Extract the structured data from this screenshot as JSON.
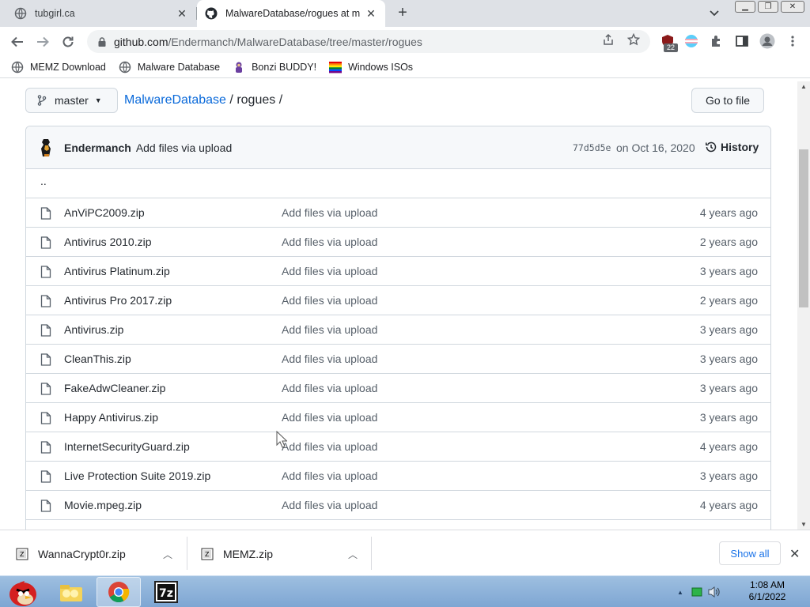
{
  "browser": {
    "tabs": [
      {
        "title": "tubgirl.ca",
        "active": false
      },
      {
        "title": "MalwareDatabase/rogues at m",
        "active": true
      }
    ],
    "new_tab_label": "+",
    "url_host": "github.com",
    "url_path": "/Endermanch/MalwareDatabase/tree/master/rogues",
    "extension_badge": "22",
    "bookmarks": [
      {
        "label": "MEMZ Download",
        "icon": "globe-icon"
      },
      {
        "label": "Malware Database",
        "icon": "globe-icon"
      },
      {
        "label": "Bonzi BUDDY!",
        "icon": "bonzi-icon"
      },
      {
        "label": "Windows ISOs",
        "icon": "windows-flag-icon"
      }
    ]
  },
  "repo": {
    "branch": "master",
    "repo_name": "MalwareDatabase",
    "folder": "rogues",
    "breadcrumb_sep": "/",
    "go_to_file": "Go to file",
    "commit": {
      "author": "Endermanch",
      "message": "Add files via upload",
      "sha": "77d5d5e",
      "date": "on Oct 16, 2020",
      "history_label": "History"
    },
    "parent_dir": "..",
    "files": [
      {
        "name": "AnViPC2009.zip",
        "message": "Add files via upload",
        "age": "4 years ago"
      },
      {
        "name": "Antivirus 2010.zip",
        "message": "Add files via upload",
        "age": "2 years ago"
      },
      {
        "name": "Antivirus Platinum.zip",
        "message": "Add files via upload",
        "age": "3 years ago"
      },
      {
        "name": "Antivirus Pro 2017.zip",
        "message": "Add files via upload",
        "age": "2 years ago"
      },
      {
        "name": "Antivirus.zip",
        "message": "Add files via upload",
        "age": "3 years ago"
      },
      {
        "name": "CleanThis.zip",
        "message": "Add files via upload",
        "age": "3 years ago"
      },
      {
        "name": "FakeAdwCleaner.zip",
        "message": "Add files via upload",
        "age": "3 years ago"
      },
      {
        "name": "Happy Antivirus.zip",
        "message": "Add files via upload",
        "age": "3 years ago"
      },
      {
        "name": "InternetSecurityGuard.zip",
        "message": "Add files via upload",
        "age": "4 years ago"
      },
      {
        "name": "Live Protection Suite 2019.zip",
        "message": "Add files via upload",
        "age": "3 years ago"
      },
      {
        "name": "Movie.mpeg.zip",
        "message": "Add files via upload",
        "age": "4 years ago"
      }
    ]
  },
  "downloads": {
    "items": [
      {
        "name": "WannaCrypt0r.zip"
      },
      {
        "name": "MEMZ.zip"
      }
    ],
    "show_all": "Show all"
  },
  "taskbar": {
    "time": "1:08 AM",
    "date": "6/1/2022"
  },
  "colors": {
    "link": "#0969da",
    "border": "#d0d7de",
    "header_bg": "#f6f8fa",
    "muted_text": "#57606a"
  }
}
